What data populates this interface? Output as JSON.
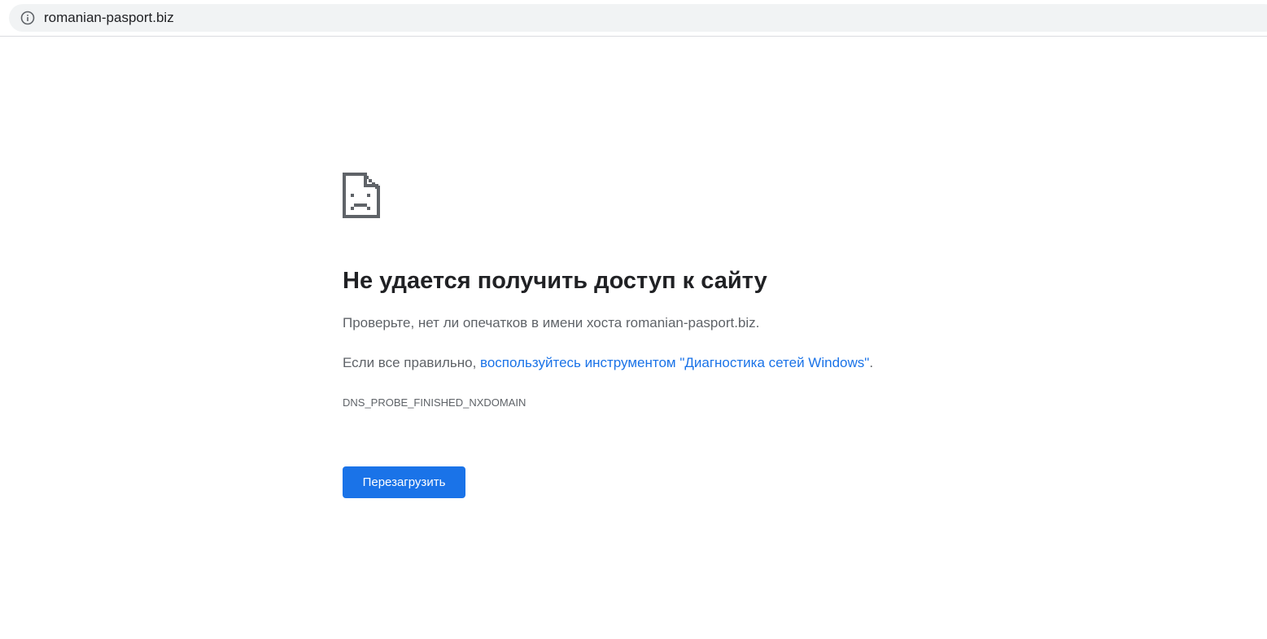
{
  "browser": {
    "url": "romanian-pasport.biz",
    "icons": {
      "info": "info-circle-icon"
    }
  },
  "error_page": {
    "icon": "sad-document-icon",
    "title": "Не удается получить доступ к сайту",
    "check_text": "Проверьте, нет ли опечатков в имени хоста romanian-pasport.biz.",
    "if_correct_prefix": "Если все правильно, ",
    "diagnostics_link": "воспользуйтесь инструментом \"Диагностика сетей Windows\"",
    "if_correct_suffix": ".",
    "error_code": "DNS_PROBE_FINISHED_NXDOMAIN",
    "reload_label": "Перезагрузить"
  },
  "colors": {
    "accent": "#1a73e8",
    "text_primary": "#202124",
    "text_secondary": "#5f6368",
    "omnibox_bg": "#f1f3f4"
  }
}
